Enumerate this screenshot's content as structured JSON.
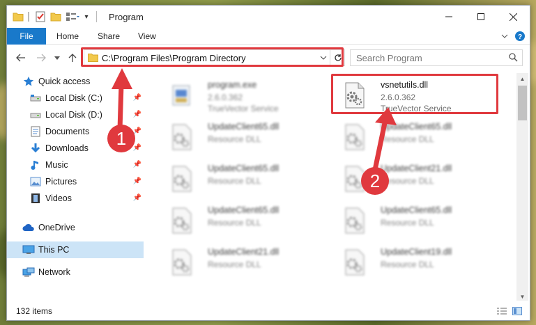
{
  "window": {
    "title": "Program"
  },
  "ribbon": {
    "file_label": "File",
    "tabs": [
      "Home",
      "Share",
      "View"
    ]
  },
  "address": {
    "path": "C:\\Program Files\\Program Directory"
  },
  "search": {
    "placeholder": "Search Program"
  },
  "sidebar": {
    "items": [
      {
        "label": "Quick access",
        "icon": "star-icon"
      },
      {
        "label": "Local Disk (C:)",
        "icon": "drive-icon",
        "pinned": true
      },
      {
        "label": "Local Disk (D:)",
        "icon": "drive-icon",
        "pinned": true
      },
      {
        "label": "Documents",
        "icon": "documents-icon",
        "pinned": true
      },
      {
        "label": "Downloads",
        "icon": "download-icon",
        "pinned": true
      },
      {
        "label": "Music",
        "icon": "music-icon",
        "pinned": true
      },
      {
        "label": "Pictures",
        "icon": "pictures-icon",
        "pinned": true
      },
      {
        "label": "Videos",
        "icon": "videos-icon",
        "pinned": true
      },
      {
        "label": "OneDrive",
        "icon": "cloud-icon"
      },
      {
        "label": "This PC",
        "icon": "computer-icon",
        "selected": true
      },
      {
        "label": "Network",
        "icon": "network-icon"
      }
    ]
  },
  "files": [
    {
      "name": "program.exe",
      "line1": "2.6.0.362",
      "line2": "TrueVector Service",
      "kind": "exe"
    },
    {
      "name": "vsnetutils.dll",
      "line1": "2.6.0.362",
      "line2": "TrueVector Service",
      "kind": "dll",
      "highlighted": true
    },
    {
      "name": "UpdateClient65.dll",
      "line1": "Resource DLL",
      "kind": "dll"
    },
    {
      "name": "UpdateClient65.dll",
      "line1": "Resource DLL",
      "kind": "dll"
    },
    {
      "name": "UpdateClient65.dll",
      "line1": "Resource DLL",
      "kind": "dll"
    },
    {
      "name": "UpdateClient21.dll",
      "line1": "Resource DLL",
      "kind": "dll"
    },
    {
      "name": "UpdateClient65.dll",
      "line1": "Resource DLL",
      "kind": "dll"
    },
    {
      "name": "UpdateClient65.dll",
      "line1": "Resource DLL",
      "kind": "dll"
    },
    {
      "name": "UpdateClient21.dll",
      "line1": "Resource DLL",
      "kind": "dll"
    },
    {
      "name": "UpdateClient19.dll",
      "line1": "Resource DLL",
      "kind": "dll"
    }
  ],
  "status": {
    "item_count": "132 items"
  },
  "annotations": {
    "step1": "1",
    "step2": "2",
    "accent": "#e0393e"
  },
  "colors": {
    "file_tab": "#1979ca",
    "selected": "#cce4f7"
  }
}
